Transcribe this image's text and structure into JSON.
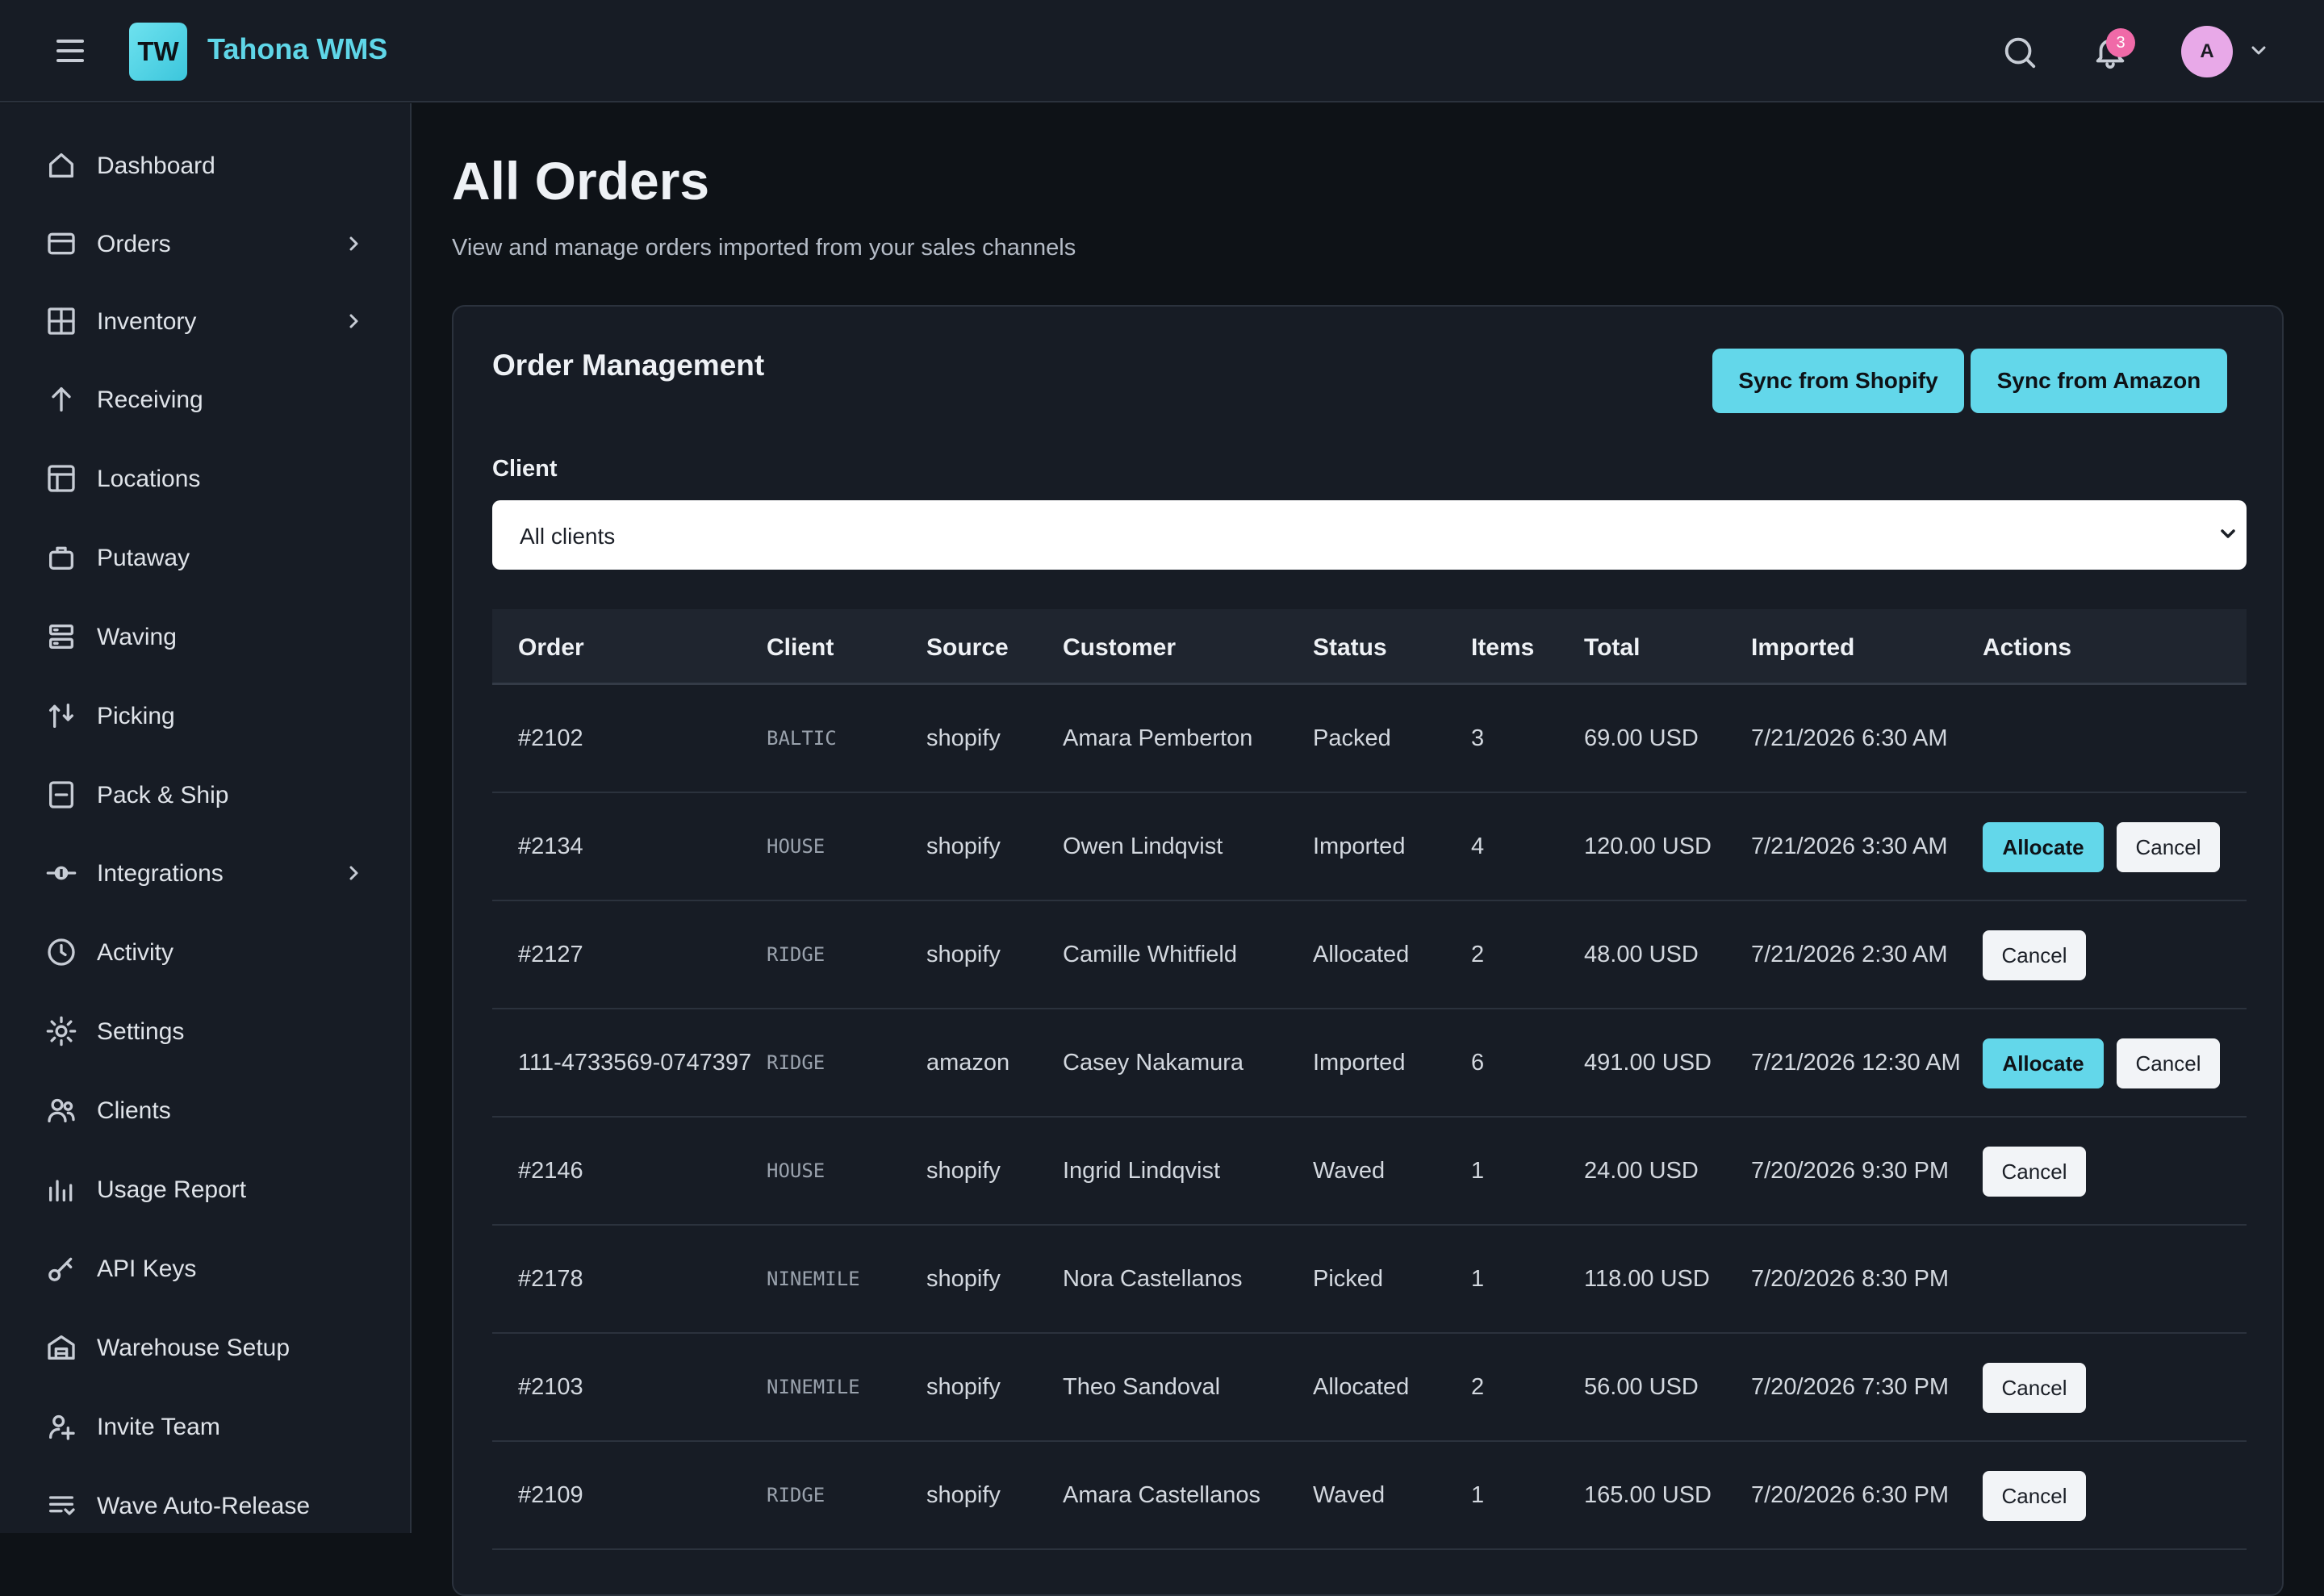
{
  "app": {
    "logo": "TW",
    "title": "Tahona WMS"
  },
  "topbar": {
    "notification_count": "3",
    "avatar_initial": "A"
  },
  "sidebar": {
    "items": [
      {
        "label": "Dashboard",
        "icon": "home-icon",
        "expandable": false
      },
      {
        "label": "Orders",
        "icon": "orders-icon",
        "expandable": true
      },
      {
        "label": "Inventory",
        "icon": "grid-icon",
        "expandable": true
      },
      {
        "label": "Receiving",
        "icon": "arrow-up-icon",
        "expandable": false
      },
      {
        "label": "Locations",
        "icon": "layout-icon",
        "expandable": false
      },
      {
        "label": "Putaway",
        "icon": "box-icon",
        "expandable": false
      },
      {
        "label": "Waving",
        "icon": "stack-icon",
        "expandable": false
      },
      {
        "label": "Picking",
        "icon": "pick-icon",
        "expandable": false
      },
      {
        "label": "Pack & Ship",
        "icon": "package-icon",
        "expandable": false
      },
      {
        "label": "Integrations",
        "icon": "plug-icon",
        "expandable": true
      },
      {
        "label": "Activity",
        "icon": "clock-icon",
        "expandable": false
      },
      {
        "label": "Settings",
        "icon": "gear-icon",
        "expandable": false
      },
      {
        "label": "Clients",
        "icon": "users-icon",
        "expandable": false
      },
      {
        "label": "Usage Report",
        "icon": "bar-chart-icon",
        "expandable": false
      },
      {
        "label": "API Keys",
        "icon": "key-icon",
        "expandable": false
      },
      {
        "label": "Warehouse Setup",
        "icon": "warehouse-icon",
        "expandable": false
      },
      {
        "label": "Invite Team",
        "icon": "user-plus-icon",
        "expandable": false
      },
      {
        "label": "Wave Auto-Release",
        "icon": "list-icon",
        "expandable": false
      }
    ]
  },
  "page": {
    "title": "All Orders",
    "subtitle": "View and manage orders imported from your sales channels"
  },
  "card": {
    "title": "Order Management",
    "sync_shopify": "Sync from Shopify",
    "sync_amazon": "Sync from Amazon",
    "client_label": "Client",
    "client_value": "All clients"
  },
  "table": {
    "columns": [
      "Order",
      "Client",
      "Source",
      "Customer",
      "Status",
      "Items",
      "Total",
      "Imported",
      "Actions"
    ],
    "rows": [
      {
        "order": "#2102",
        "client": "BALTIC",
        "source": "shopify",
        "customer": "Amara Pemberton",
        "status": "Packed",
        "items": "3",
        "total": "69.00 USD",
        "imported": "7/21/2026 6:30 AM",
        "actions": []
      },
      {
        "order": "#2134",
        "client": "HOUSE",
        "source": "shopify",
        "customer": "Owen Lindqvist",
        "status": "Imported",
        "items": "4",
        "total": "120.00 USD",
        "imported": "7/21/2026 3:30 AM",
        "actions": [
          "Allocate",
          "Cancel"
        ]
      },
      {
        "order": "#2127",
        "client": "RIDGE",
        "source": "shopify",
        "customer": "Camille Whitfield",
        "status": "Allocated",
        "items": "2",
        "total": "48.00 USD",
        "imported": "7/21/2026 2:30 AM",
        "actions": [
          "Cancel"
        ]
      },
      {
        "order": "111-4733569-0747397",
        "client": "RIDGE",
        "source": "amazon",
        "customer": "Casey Nakamura",
        "status": "Imported",
        "items": "6",
        "total": "491.00 USD",
        "imported": "7/21/2026 12:30 AM",
        "actions": [
          "Allocate",
          "Cancel"
        ]
      },
      {
        "order": "#2146",
        "client": "HOUSE",
        "source": "shopify",
        "customer": "Ingrid Lindqvist",
        "status": "Waved",
        "items": "1",
        "total": "24.00 USD",
        "imported": "7/20/2026 9:30 PM",
        "actions": [
          "Cancel"
        ]
      },
      {
        "order": "#2178",
        "client": "NINEMILE",
        "source": "shopify",
        "customer": "Nora Castellanos",
        "status": "Picked",
        "items": "1",
        "total": "118.00 USD",
        "imported": "7/20/2026 8:30 PM",
        "actions": []
      },
      {
        "order": "#2103",
        "client": "NINEMILE",
        "source": "shopify",
        "customer": "Theo Sandoval",
        "status": "Allocated",
        "items": "2",
        "total": "56.00 USD",
        "imported": "7/20/2026 7:30 PM",
        "actions": [
          "Cancel"
        ]
      },
      {
        "order": "#2109",
        "client": "RIDGE",
        "source": "shopify",
        "customer": "Amara Castellanos",
        "status": "Waved",
        "items": "1",
        "total": "165.00 USD",
        "imported": "7/20/2026 6:30 PM",
        "actions": [
          "Cancel"
        ]
      }
    ]
  },
  "colors": {
    "accent": "#63d7ea",
    "brand": "#5fd6e8",
    "badge": "#f06aa8",
    "avatar": "#e8a9e8"
  }
}
